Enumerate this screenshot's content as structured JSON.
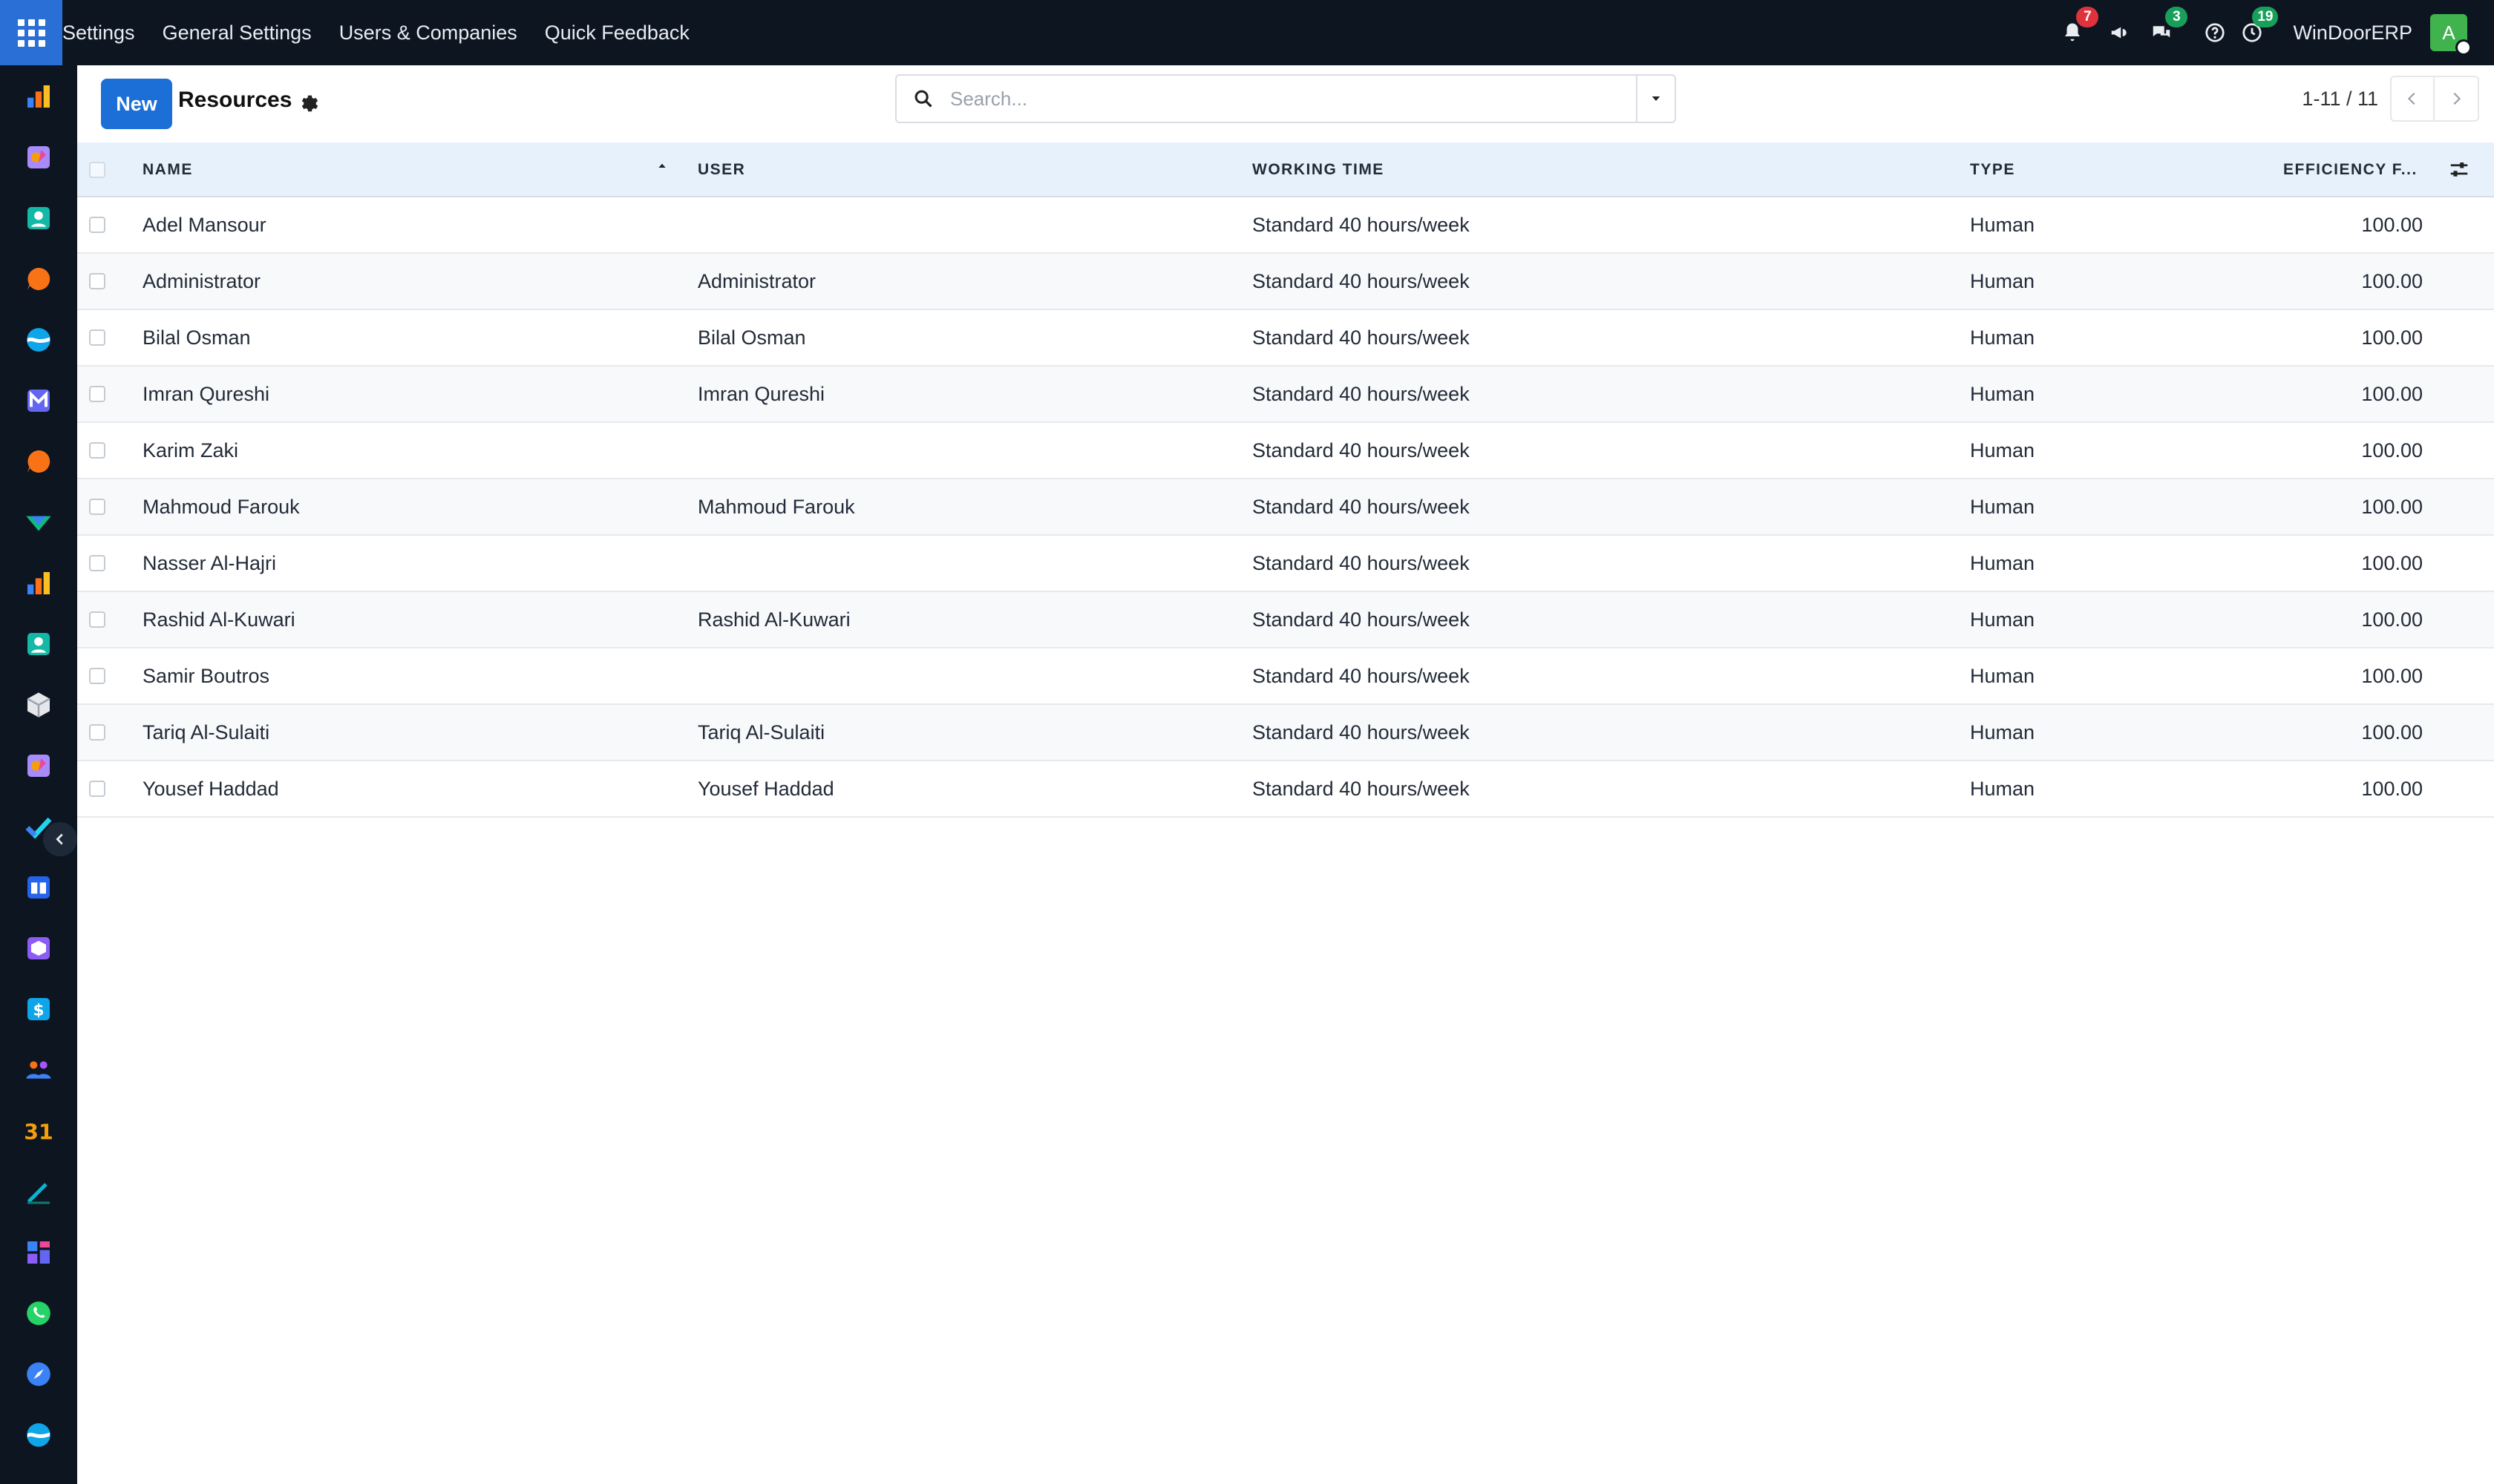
{
  "topbar": {
    "menu": [
      "Settings",
      "General Settings",
      "Users & Companies",
      "Quick Feedback"
    ],
    "badges": {
      "activities": "7",
      "messages": "3",
      "timer": "19"
    },
    "company": "WinDoorERP",
    "avatar_letter": "A",
    "colors": {
      "background": "#0d1521",
      "apps_button": "#2a6fd6",
      "badge_red": "#e0323c",
      "badge_green": "#18a05b",
      "avatar": "#40b34f"
    }
  },
  "sidebar": {
    "apps": [
      "bar-chart-icon",
      "paint-icon",
      "contacts-icon",
      "chat-bubble-icon",
      "wave-icon",
      "mail-icon",
      "discuss-icon",
      "shipping-icon",
      "bar-chart-icon",
      "contacts-icon",
      "cube-icon",
      "paint-icon",
      "checkmark-icon",
      "book-icon",
      "box-icon",
      "dollar-icon",
      "people-icon",
      "calendar-icon",
      "sign-icon",
      "dashboard-icon",
      "whatsapp-icon",
      "compass-icon",
      "wave-icon"
    ],
    "calendar_label": "31"
  },
  "control": {
    "new_label": "New",
    "title": "Resources",
    "search_placeholder": "Search...",
    "pager_value": "1-11 / 11",
    "accent": "#1b6fd6"
  },
  "table": {
    "columns": {
      "name": "NAME",
      "user": "USER",
      "working_time": "WORKING TIME",
      "type": "TYPE",
      "efficiency": "EFFICIENCY F..."
    },
    "rows": [
      {
        "name": "Adel Mansour",
        "user": "",
        "working_time": "Standard 40 hours/week",
        "type": "Human",
        "efficiency": "100.00"
      },
      {
        "name": "Administrator",
        "user": "Administrator",
        "working_time": "Standard 40 hours/week",
        "type": "Human",
        "efficiency": "100.00"
      },
      {
        "name": "Bilal Osman",
        "user": "Bilal Osman",
        "working_time": "Standard 40 hours/week",
        "type": "Human",
        "efficiency": "100.00"
      },
      {
        "name": "Imran Qureshi",
        "user": "Imran Qureshi",
        "working_time": "Standard 40 hours/week",
        "type": "Human",
        "efficiency": "100.00"
      },
      {
        "name": "Karim Zaki",
        "user": "",
        "working_time": "Standard 40 hours/week",
        "type": "Human",
        "efficiency": "100.00"
      },
      {
        "name": "Mahmoud Farouk",
        "user": "Mahmoud Farouk",
        "working_time": "Standard 40 hours/week",
        "type": "Human",
        "efficiency": "100.00"
      },
      {
        "name": "Nasser Al-Hajri",
        "user": "",
        "working_time": "Standard 40 hours/week",
        "type": "Human",
        "efficiency": "100.00"
      },
      {
        "name": "Rashid Al-Kuwari",
        "user": "Rashid Al-Kuwari",
        "working_time": "Standard 40 hours/week",
        "type": "Human",
        "efficiency": "100.00"
      },
      {
        "name": "Samir Boutros",
        "user": "",
        "working_time": "Standard 40 hours/week",
        "type": "Human",
        "efficiency": "100.00"
      },
      {
        "name": "Tariq Al-Sulaiti",
        "user": "Tariq Al-Sulaiti",
        "working_time": "Standard 40 hours/week",
        "type": "Human",
        "efficiency": "100.00"
      },
      {
        "name": "Yousef Haddad",
        "user": "Yousef Haddad",
        "working_time": "Standard 40 hours/week",
        "type": "Human",
        "efficiency": "100.00"
      }
    ]
  }
}
